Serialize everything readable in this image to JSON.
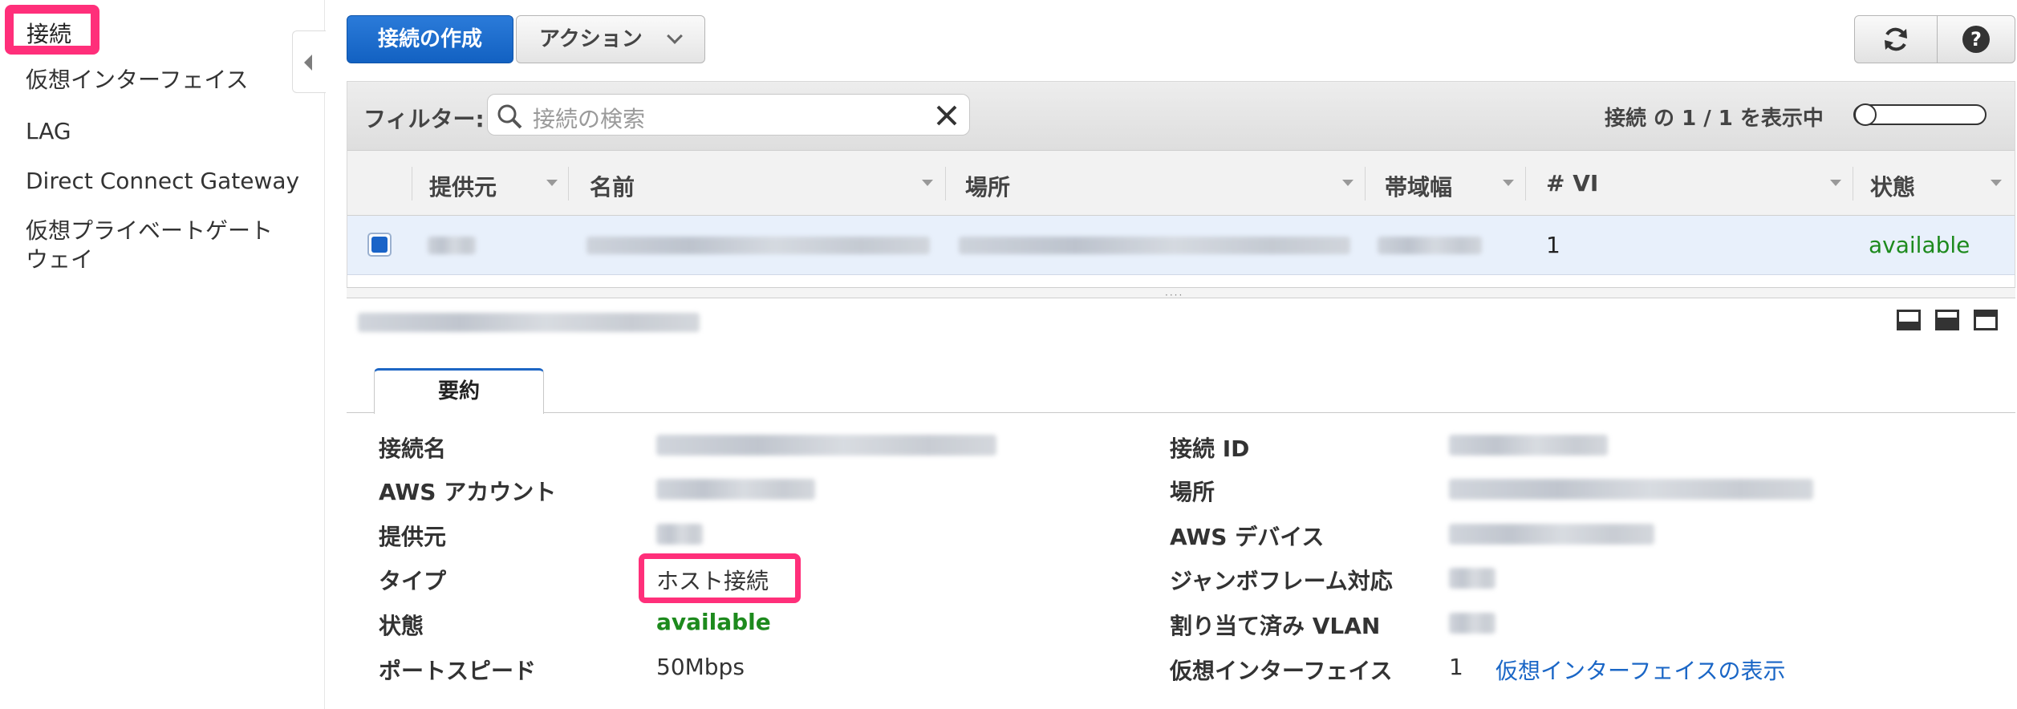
{
  "sidebar": {
    "items": [
      {
        "label": "接続",
        "active": true
      },
      {
        "label": "仮想インターフェイス"
      },
      {
        "label": "LAG"
      },
      {
        "label": "Direct Connect Gateway"
      },
      {
        "label": "仮想プライベートゲート ウェイ"
      }
    ]
  },
  "toolbar": {
    "create_label": "接続の作成",
    "action_label": "アクション",
    "refresh_icon": "refresh-icon",
    "help_icon": "help-icon"
  },
  "filter": {
    "label": "フィルター:",
    "placeholder": "接続の検索",
    "count_text": "接続 の 1 / 1 を表示中"
  },
  "table": {
    "columns": [
      "提供元",
      "名前",
      "場所",
      "帯域幅",
      "# VI",
      "状態"
    ],
    "rows": [
      {
        "vi": "1",
        "state": "available",
        "selected": true
      }
    ]
  },
  "detail": {
    "tab_label": "要約",
    "left": [
      {
        "label": "接続名"
      },
      {
        "label": "AWS アカウント"
      },
      {
        "label": "提供元"
      },
      {
        "label": "タイプ",
        "value": "ホスト接続"
      },
      {
        "label": "状態",
        "value": "available"
      },
      {
        "label": "ポートスピード",
        "value": "50Mbps"
      }
    ],
    "right": [
      {
        "label": "接続 ID"
      },
      {
        "label": "場所"
      },
      {
        "label": "AWS デバイス"
      },
      {
        "label": "ジャンボフレーム対応"
      },
      {
        "label": "割り当て済み VLAN"
      },
      {
        "label": "仮想インターフェイス",
        "value": "1",
        "link": "仮想インターフェイスの表示"
      }
    ]
  },
  "colors": {
    "primary": "#1261c2",
    "highlight": "#ff2f7a",
    "available": "#1d8a1d",
    "link": "#1a66c6"
  }
}
